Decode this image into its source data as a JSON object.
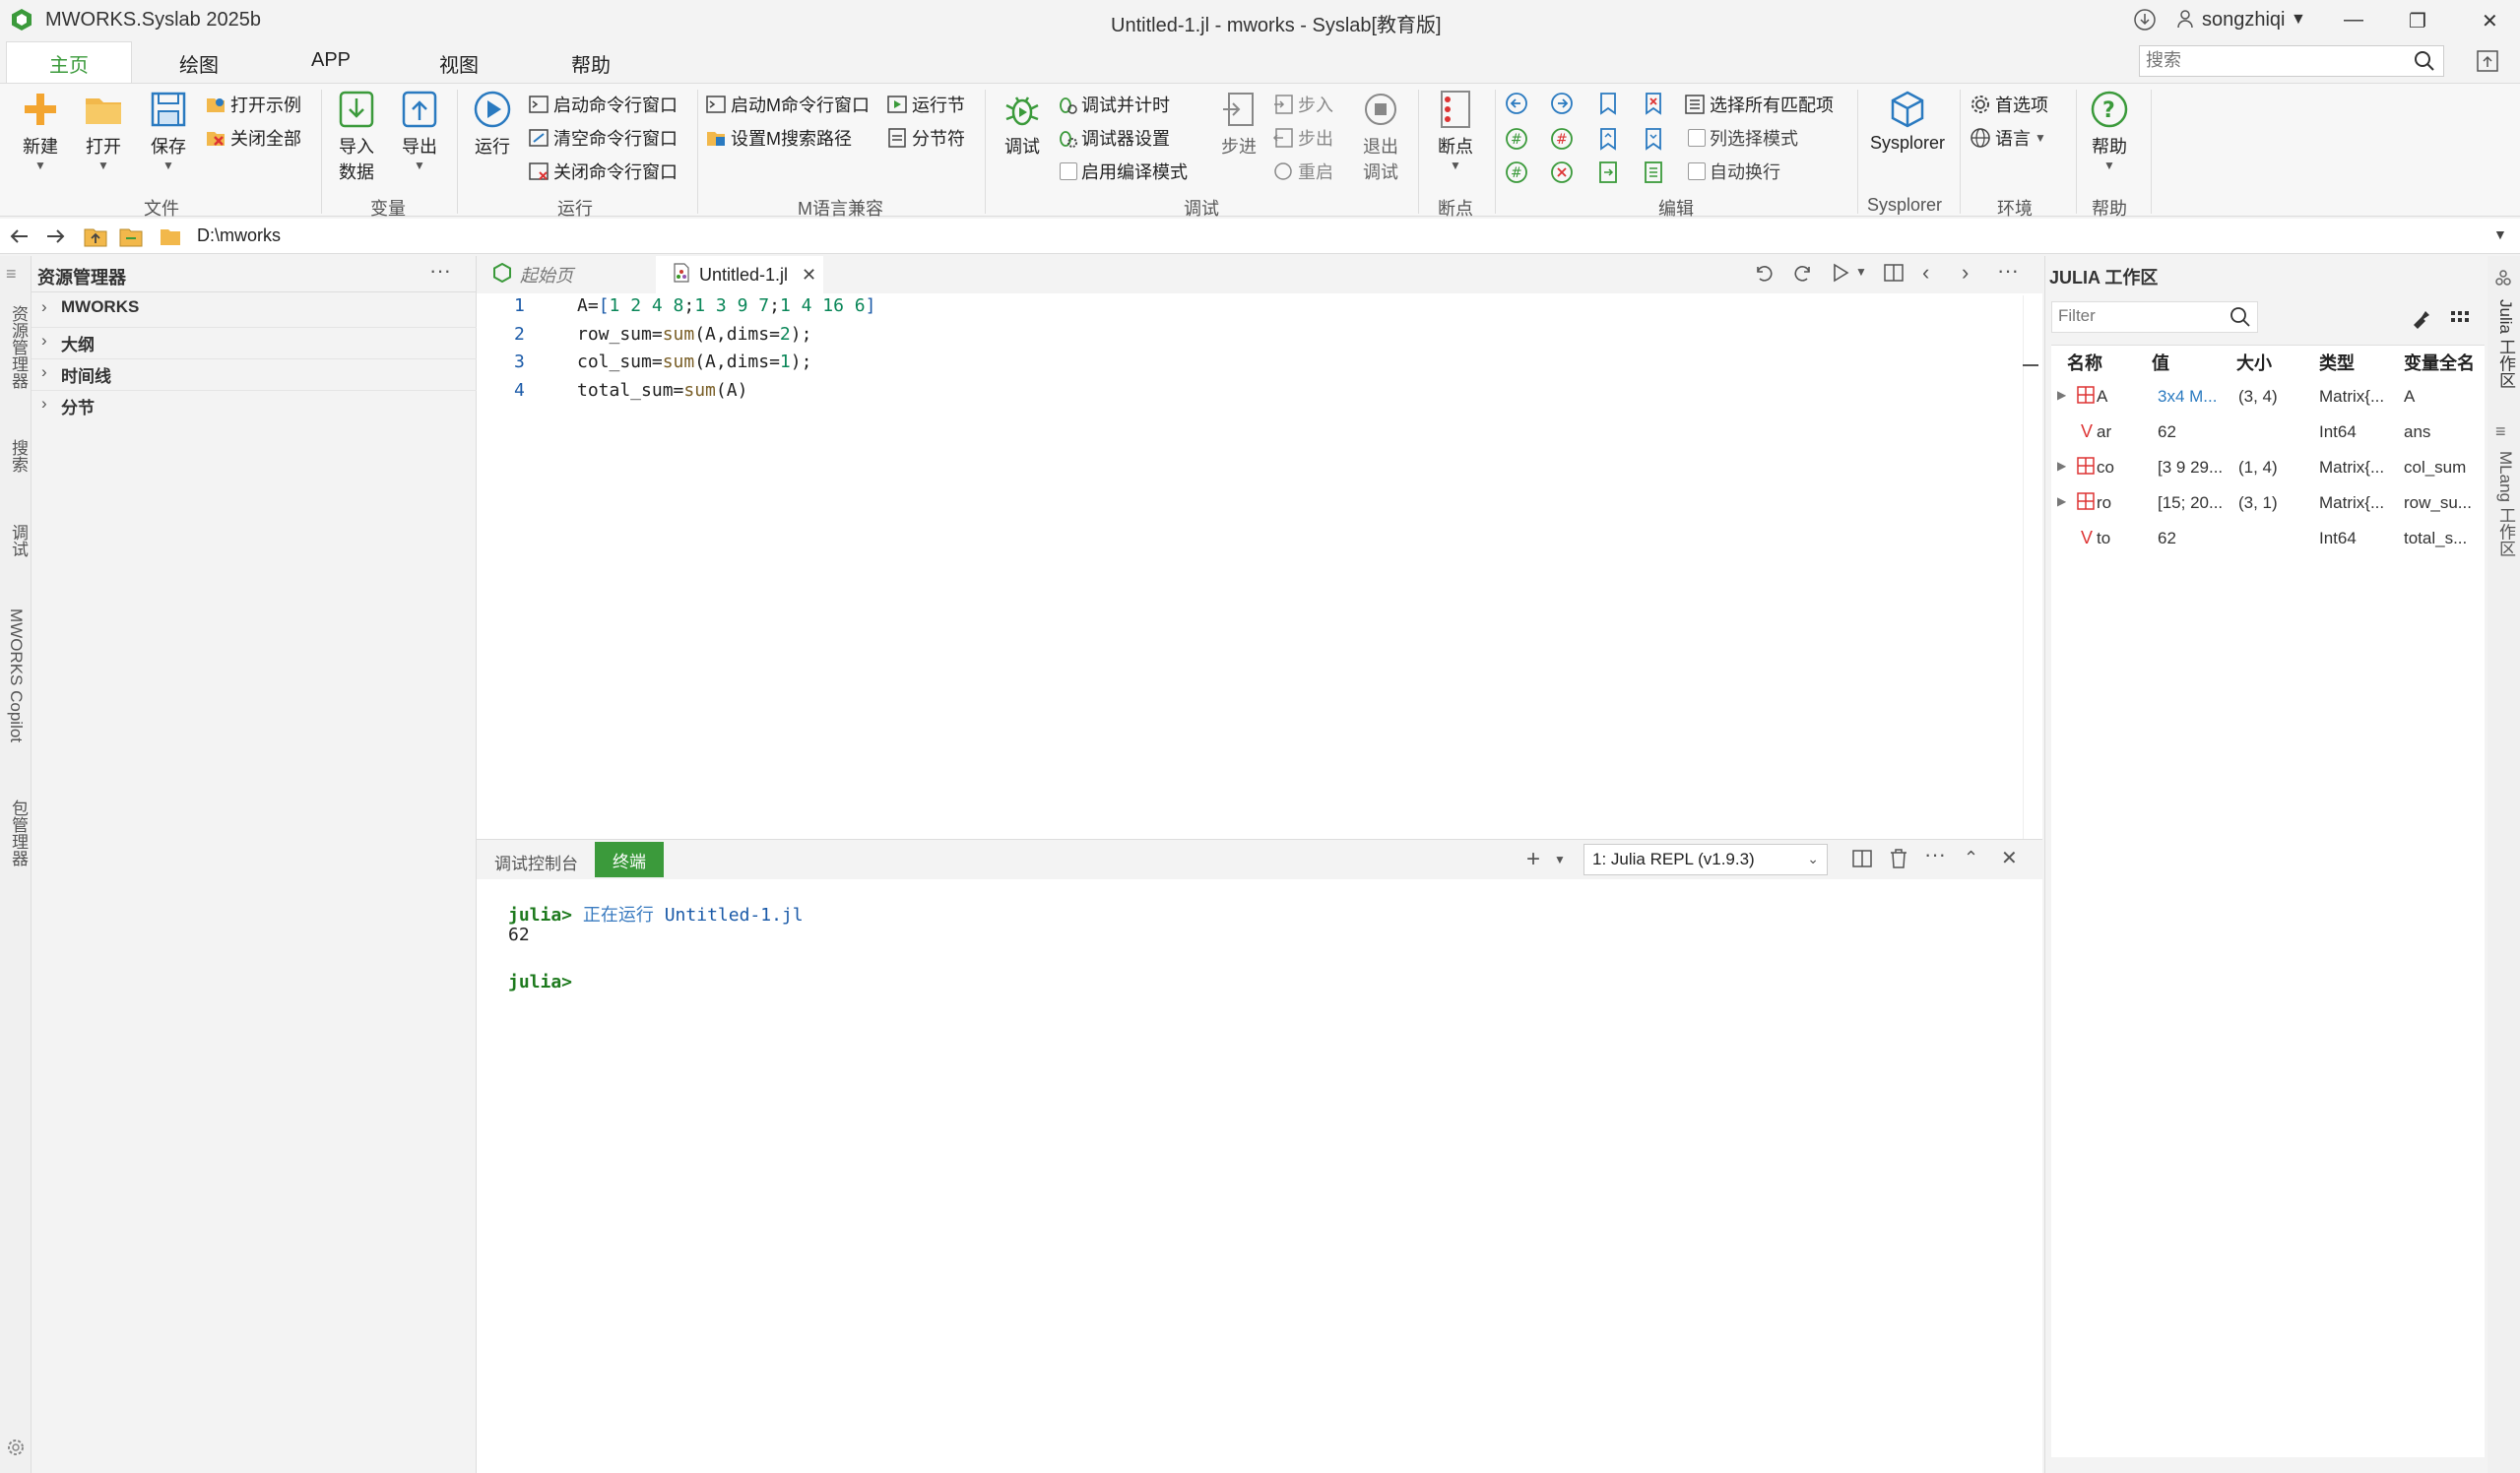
{
  "titlebar": {
    "app": "MWORKS.Syslab 2025b",
    "title": "Untitled-1.jl - mworks - Syslab[教育版]",
    "user": "songzhiqi",
    "search_placeholder": "搜索"
  },
  "tabs": [
    "主页",
    "绘图",
    "APP",
    "视图",
    "帮助"
  ],
  "ribbon": {
    "file": {
      "new": "新建",
      "open": "打开",
      "save": "保存",
      "open_example": "打开示例",
      "close_all": "关闭全部",
      "label": "文件"
    },
    "variable": {
      "import": "导入\n数据",
      "import_line1": "导入",
      "import_line2": "数据",
      "export": "导出",
      "label": "变量"
    },
    "run": {
      "run": "运行",
      "start_cmd": "启动命令行窗口",
      "clear_cmd": "清空命令行窗口",
      "close_cmd": "关闭命令行窗口",
      "label": "运行"
    },
    "mcompat": {
      "start_m": "启动M命令行窗口",
      "set_path": "设置M搜索路径",
      "run_section": "运行节",
      "section_break": "分节符",
      "label": "M语言兼容"
    },
    "debug": {
      "debug": "调试",
      "debug_timer": "调试并计时",
      "debugger_settings": "调试器设置",
      "compile_mode": "启用编译模式",
      "step": "步进",
      "step_in": "步入",
      "step_out": "步出",
      "restart": "重启",
      "exit_debug_1": "退出",
      "exit_debug_2": "调试",
      "label": "调试"
    },
    "breakpoints": {
      "bp": "断点",
      "label": "断点"
    },
    "edit": {
      "select_all_matches": "选择所有匹配项",
      "column_mode": "列选择模式",
      "auto_wrap": "自动换行",
      "label": "编辑"
    },
    "sysplorer": {
      "name": "Sysplorer",
      "label": "Sysplorer"
    },
    "env": {
      "prefs": "首选项",
      "lang": "语言",
      "label": "环境"
    },
    "help": {
      "help": "帮助",
      "label": "帮助"
    }
  },
  "address": {
    "path": "D:\\mworks"
  },
  "left_strip": [
    "资源管理器",
    "搜索",
    "调试",
    "MWORKS Copilot",
    "包管理器"
  ],
  "explorer": {
    "title": "资源管理器",
    "items": [
      "MWORKS",
      "大纲",
      "时间线",
      "分节"
    ]
  },
  "editor": {
    "tabs": [
      {
        "label": "起始页"
      },
      {
        "label": "Untitled-1.jl"
      }
    ],
    "lines": [
      {
        "n": "1",
        "text": "A=[1 2 4 8;1 3 9 7;1 4 16 6]"
      },
      {
        "n": "2",
        "text": "row_sum=sum(A,dims=2);"
      },
      {
        "n": "3",
        "text": "col_sum=sum(A,dims=1);"
      },
      {
        "n": "4",
        "text": "total_sum=sum(A)"
      }
    ]
  },
  "panel": {
    "tabs": [
      "调试控制台",
      "终端"
    ],
    "repl": "1: Julia REPL (v1.9.3)",
    "output": {
      "prompt": "julia>",
      "running": "正在运行",
      "file": "Untitled-1.jl",
      "result": "62"
    }
  },
  "workspace": {
    "title": "JULIA 工作区",
    "filter_placeholder": "Filter",
    "headers": [
      "名称",
      "值",
      "大小",
      "类型",
      "变量全名"
    ],
    "rows": [
      {
        "name": "A",
        "value": "3x4 M...",
        "size": "(3, 4)",
        "type": "Matrix{...",
        "full": "A"
      },
      {
        "name": "ar",
        "value": "62",
        "size": "",
        "type": "Int64",
        "full": "ans"
      },
      {
        "name": "co",
        "value": "[3 9 29...",
        "size": "(1, 4)",
        "type": "Matrix{...",
        "full": "col_sum"
      },
      {
        "name": "ro",
        "value": "[15; 20...",
        "size": "(3, 1)",
        "type": "Matrix{...",
        "full": "row_su..."
      },
      {
        "name": "to",
        "value": "62",
        "size": "",
        "type": "Int64",
        "full": "total_s..."
      }
    ]
  },
  "right_strip": [
    "Julia 工作区",
    "MLang 工作区"
  ],
  "colors": {
    "accent": "#3b9a3b",
    "blue": "#1a6fb0"
  }
}
